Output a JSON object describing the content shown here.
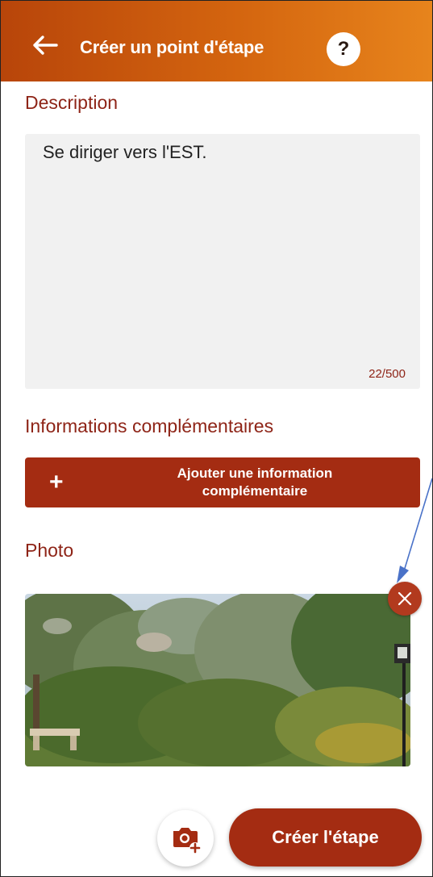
{
  "header": {
    "title": "Créer un point d'étape",
    "back_icon": "arrow-left-icon",
    "help_label": "?"
  },
  "description": {
    "section_title": "Description",
    "value": "Se diriger vers l'EST.",
    "counter": "22/500"
  },
  "extra_info": {
    "section_title": "Informations complémentaires",
    "add_button_line1": "Ajouter une information",
    "add_button_line2": "complémentaire",
    "add_icon": "plus-icon"
  },
  "photo": {
    "section_title": "Photo",
    "remove_icon": "close-icon"
  },
  "footer": {
    "camera_icon": "add-photo-icon",
    "create_button": "Créer l'étape"
  },
  "colors": {
    "header_start": "#b8450a",
    "header_end": "#e7841c",
    "accent": "#a42c12",
    "section_title": "#8e2417",
    "annotation_arrow": "#4a72c8"
  }
}
